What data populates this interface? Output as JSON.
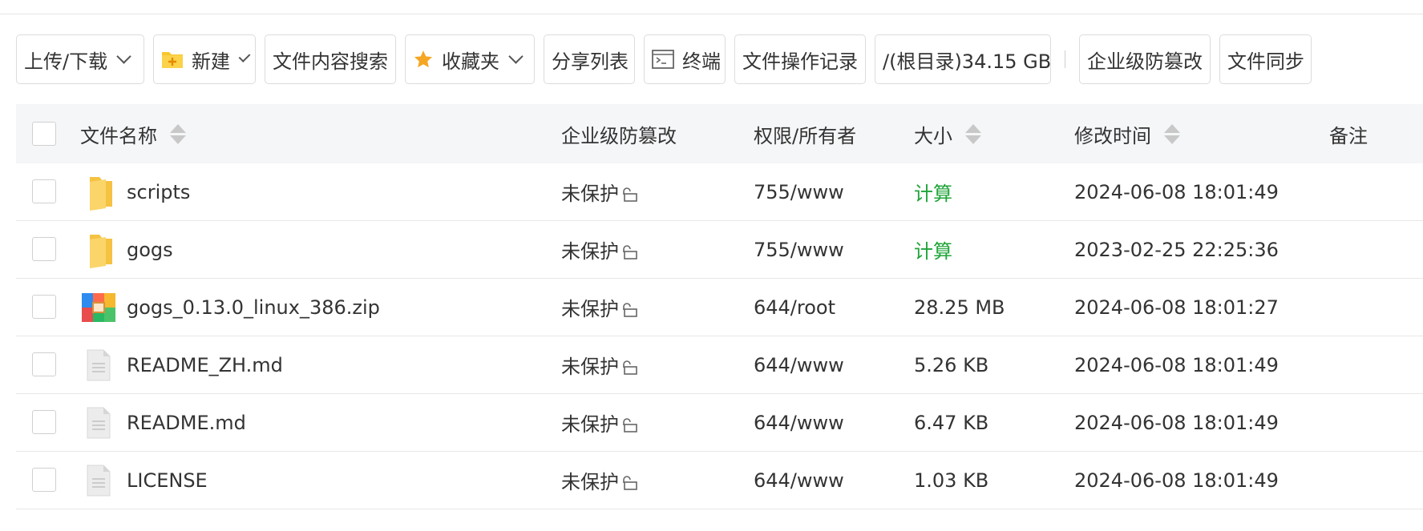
{
  "toolbar": {
    "upload_download": "上传/下载",
    "new": "新建",
    "content_search": "文件内容搜索",
    "favorites": "收藏夹",
    "share_list": "分享列表",
    "terminal": "终端",
    "operation_log": "文件操作记录",
    "disk": "/(根目录)34.15 GB",
    "tamper_proof": "企业级防篡改",
    "file_sync": "文件同步"
  },
  "table": {
    "headers": {
      "name": "文件名称",
      "tamper": "企业级防篡改",
      "perm": "权限/所有者",
      "size": "大小",
      "mtime": "修改时间",
      "note": "备注"
    },
    "rows": [
      {
        "icon": "folder-icon",
        "name": "scripts",
        "tamper": "未保护",
        "perm": "755/www",
        "size": "计算",
        "mtime": "2024-06-08 18:01:49",
        "note": ""
      },
      {
        "icon": "folder-icon",
        "name": "gogs",
        "tamper": "未保护",
        "perm": "755/www",
        "size": "计算",
        "mtime": "2023-02-25 22:25:36",
        "note": ""
      },
      {
        "icon": "zip-archive-icon",
        "name": "gogs_0.13.0_linux_386.zip",
        "tamper": "未保护",
        "perm": "644/root",
        "size": "28.25 MB",
        "mtime": "2024-06-08 18:01:27",
        "note": ""
      },
      {
        "icon": "text-file-icon",
        "name": "README_ZH.md",
        "tamper": "未保护",
        "perm": "644/www",
        "size": "5.26 KB",
        "mtime": "2024-06-08 18:01:49",
        "note": ""
      },
      {
        "icon": "text-file-icon",
        "name": "README.md",
        "tamper": "未保护",
        "perm": "644/www",
        "size": "6.47 KB",
        "mtime": "2024-06-08 18:01:49",
        "note": ""
      },
      {
        "icon": "text-file-icon",
        "name": "LICENSE",
        "tamper": "未保护",
        "perm": "644/www",
        "size": "1.03 KB",
        "mtime": "2024-06-08 18:01:49",
        "note": ""
      }
    ]
  },
  "colors": {
    "size_link": "#20a53a",
    "header_bg": "#f5f6f8",
    "border": "#dcdcdc"
  }
}
